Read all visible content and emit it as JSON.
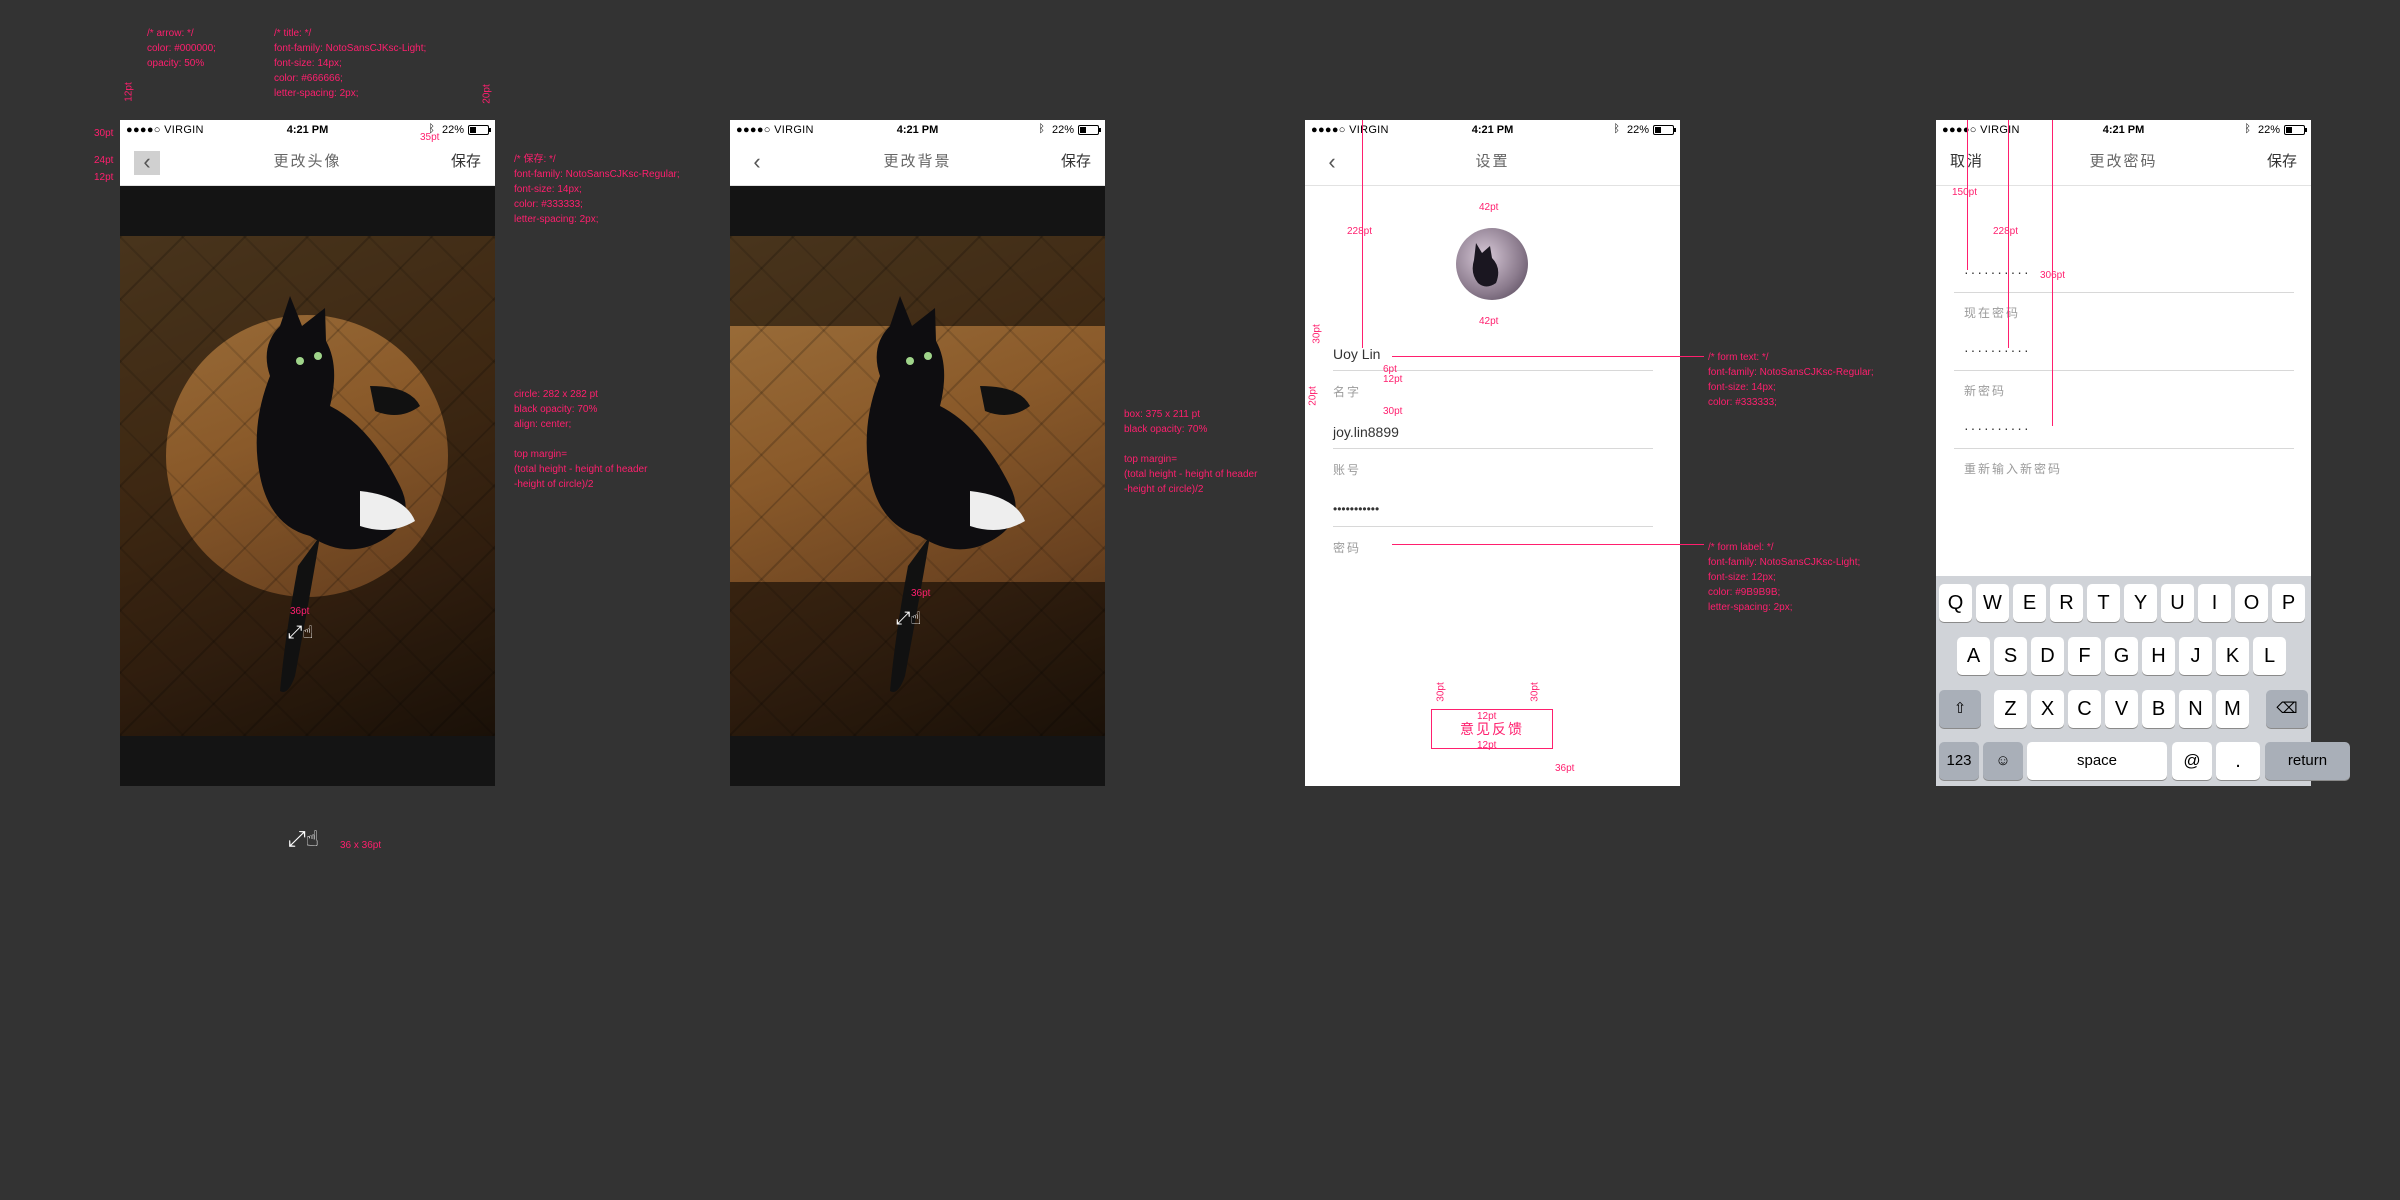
{
  "status": {
    "carrier": "●●●●○ VIRGIN",
    "time": "4:21 PM",
    "battery": "22%",
    "bluetooth_icon": "bluetooth-icon",
    "wifi_icon": "wifi-icon"
  },
  "screen1": {
    "title": "更改头像",
    "save": "保存",
    "back_icon": "chevron-left-icon"
  },
  "screen2": {
    "title": "更改背景",
    "save": "保存",
    "back_icon": "chevron-left-icon"
  },
  "screen3": {
    "title": "设置",
    "name_value": "Uoy Lin",
    "name_label": "名字",
    "account_value": "joy.lin8899",
    "account_label": "账号",
    "password_value": "•••••••••••",
    "password_label": "密码",
    "feedback": "意见反馈"
  },
  "screen4": {
    "cancel": "取消",
    "title": "更改密码",
    "save": "保存",
    "current_value": "··········",
    "current_label": "现在密码",
    "new_value": "··········",
    "new_label": "新密码",
    "confirm_value": "··········",
    "confirm_label": "重新输入新密码"
  },
  "keyboard": {
    "row1": [
      "Q",
      "W",
      "E",
      "R",
      "T",
      "Y",
      "U",
      "I",
      "O",
      "P"
    ],
    "row2": [
      "A",
      "S",
      "D",
      "F",
      "G",
      "H",
      "J",
      "K",
      "L"
    ],
    "row3": [
      "Z",
      "X",
      "C",
      "V",
      "B",
      "N",
      "M"
    ],
    "num": "123",
    "space": "space",
    "at": "@",
    "dot": ".",
    "return": "return",
    "shift_icon": "shift-icon",
    "delete_icon": "delete-icon",
    "emoji_icon": "emoji-icon"
  },
  "annotations": {
    "arrow_spec": "/* arrow: */\ncolor: #000000;\nopacity: 50%",
    "title_spec": "/* title: */\nfont-family: NotoSansCJKsc-Light;\nfont-size: 14px;\ncolor: #666666;\nletter-spacing: 2px;",
    "save_spec": "/* 保存: */\nfont-family: NotoSansCJKsc-Regular;\nfont-size: 14px;\ncolor: #333333;\nletter-spacing: 2px;",
    "circle_spec": "circle: 282 x 282 pt\nblack opacity: 70%\nalign: center;\n\ntop margin=\n(total height - height of header\n-height of circle)/2",
    "box_spec": "box: 375 x 211 pt\nblack opacity: 70%\n\ntop margin=\n(total height - height of header\n-height of circle)/2",
    "form_text_spec": "/* form text: */\nfont-family: NotoSansCJKsc-Regular;\nfont-size: 14px;\ncolor: #333333;",
    "form_label_spec": "/* form label: */\nfont-family: NotoSansCJKsc-Light;\nfont-size: 12px;\ncolor: #9B9B9B;\nletter-spacing: 2px;",
    "hand_size": "36 x 36pt",
    "d_12": "12pt",
    "d_30": "30pt",
    "d_24": "24pt",
    "d_35": "35pt",
    "d_20": "20pt",
    "d_36": "36pt",
    "d_42": "42pt",
    "d_228": "228pt",
    "d_6": "6pt",
    "d_150": "150pt",
    "d_306": "306pt"
  }
}
